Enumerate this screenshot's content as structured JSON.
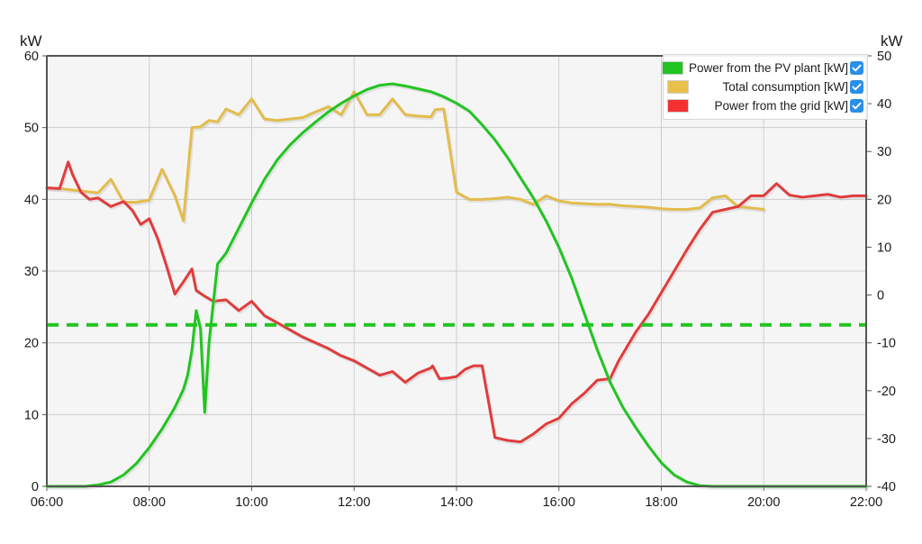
{
  "axes": {
    "left_unit": "kW",
    "right_unit": "kW",
    "left_ticks": [
      "60",
      "50",
      "40",
      "30",
      "20",
      "10",
      "0"
    ],
    "right_ticks": [
      "50",
      "40",
      "30",
      "20",
      "10",
      "0",
      "-10",
      "-20",
      "-30",
      "-40"
    ],
    "x_ticks": [
      "06:00",
      "08:00",
      "10:00",
      "12:00",
      "14:00",
      "16:00",
      "18:00",
      "20:00",
      "22:00"
    ]
  },
  "legend": {
    "items": [
      {
        "label": "Power from the PV plant [kW]",
        "color": "#22c422",
        "checked": true,
        "checkbox_color": "#2a8fe8"
      },
      {
        "label": "Total consumption [kW]",
        "color": "#e8c04a",
        "checked": true,
        "checkbox_color": "#2a8fe8"
      },
      {
        "label": "Power from the grid [kW]",
        "color": "#f43030",
        "checked": true,
        "checkbox_color": "#2a8fe8"
      }
    ]
  },
  "colors": {
    "pv": "#22c422",
    "consumption": "#e3bc4c",
    "grid": "#e03c3c",
    "plot_background": "#f2f2f2",
    "grid_line": "#c9c9c9",
    "axis_line": "#555555",
    "text": "#1a1a1a",
    "threshold": "#22c422"
  },
  "chart_data": {
    "type": "line",
    "title": "",
    "xlabel": "",
    "ylabel": "kW",
    "ylim": [
      0,
      60
    ],
    "y2lim": [
      -40,
      50
    ],
    "xlim": [
      "06:00",
      "22:00"
    ],
    "grid": true,
    "legend_position": "top-right",
    "x_tick_labels": [
      "06:00",
      "08:00",
      "10:00",
      "12:00",
      "14:00",
      "16:00",
      "18:00",
      "20:00",
      "22:00"
    ],
    "y_tick_labels": [
      "0",
      "10",
      "20",
      "30",
      "40",
      "50",
      "60"
    ],
    "y2_tick_labels": [
      "-40",
      "-30",
      "-20",
      "-10",
      "0",
      "10",
      "20",
      "30",
      "40",
      "50"
    ],
    "annotations": [
      {
        "name": "pv-threshold-dashed-line",
        "value": 22.5,
        "axis": "left",
        "style": "dashed",
        "color": "#22c422"
      }
    ],
    "x_minutes_start": 360,
    "x_minutes_end": 1320,
    "series": [
      {
        "name": "Power from the PV plant [kW]",
        "color": "#22c422",
        "axis": "left",
        "x": [
          360,
          375,
          390,
          405,
          420,
          435,
          450,
          465,
          480,
          495,
          510,
          520,
          525,
          530,
          535,
          540,
          545,
          550,
          560,
          570,
          585,
          600,
          615,
          630,
          645,
          660,
          675,
          690,
          705,
          720,
          735,
          750,
          765,
          780,
          795,
          810,
          825,
          840,
          855,
          870,
          885,
          900,
          915,
          930,
          945,
          960,
          975,
          990,
          1005,
          1020,
          1035,
          1050,
          1065,
          1080,
          1095,
          1110,
          1125,
          1140,
          1155,
          1170,
          1185,
          1200,
          1260,
          1320
        ],
        "values": [
          0,
          0,
          0,
          0,
          0.2,
          0.6,
          1.6,
          3.2,
          5.4,
          8.0,
          11.0,
          13.5,
          15.5,
          19.0,
          24.5,
          22.0,
          10.3,
          20.0,
          31.0,
          32.5,
          36.0,
          39.5,
          42.8,
          45.5,
          47.6,
          49.3,
          50.8,
          52.2,
          53.4,
          54.4,
          55.3,
          55.9,
          56.1,
          55.8,
          55.4,
          55.0,
          54.3,
          53.4,
          52.3,
          50.4,
          48.3,
          45.8,
          43.0,
          40.2,
          37.0,
          33.3,
          29.0,
          24.0,
          19.0,
          14.5,
          11.0,
          8.2,
          5.6,
          3.3,
          1.6,
          0.6,
          0.1,
          0,
          0,
          0,
          0,
          0,
          0,
          0
        ]
      },
      {
        "name": "Total consumption [kW]",
        "color": "#e3bc4c",
        "axis": "left",
        "x": [
          360,
          375,
          390,
          405,
          420,
          435,
          450,
          465,
          480,
          495,
          510,
          520,
          530,
          540,
          550,
          560,
          570,
          585,
          600,
          615,
          630,
          645,
          660,
          675,
          690,
          705,
          720,
          735,
          750,
          765,
          780,
          795,
          810,
          815,
          825,
          840,
          855,
          870,
          885,
          900,
          915,
          930,
          945,
          960,
          975,
          990,
          1005,
          1020,
          1035,
          1050,
          1065,
          1080,
          1095,
          1110,
          1125,
          1140,
          1155,
          1170,
          1185,
          1200
        ],
        "values": [
          41.6,
          41.5,
          41.3,
          41.1,
          40.9,
          42.8,
          39.6,
          39.6,
          39.9,
          44.2,
          40.5,
          37.0,
          50.0,
          50.1,
          51.0,
          50.8,
          52.6,
          51.8,
          54.0,
          51.2,
          51.0,
          51.2,
          51.4,
          52.2,
          52.9,
          51.8,
          55.0,
          51.8,
          51.8,
          54.0,
          51.8,
          51.6,
          51.5,
          52.5,
          52.6,
          41.0,
          40.0,
          40.0,
          40.1,
          40.3,
          40.0,
          39.3,
          40.5,
          39.8,
          39.5,
          39.4,
          39.3,
          39.3,
          39.1,
          39.0,
          38.9,
          38.7,
          38.6,
          38.6,
          38.8,
          40.2,
          40.5,
          39.0,
          38.8,
          38.6
        ]
      },
      {
        "name": "Power from the grid [kW]",
        "color": "#e03c3c",
        "axis": "left",
        "x": [
          360,
          375,
          385,
          390,
          400,
          410,
          420,
          435,
          450,
          460,
          470,
          480,
          490,
          500,
          510,
          520,
          530,
          535,
          545,
          555,
          570,
          585,
          600,
          615,
          630,
          645,
          660,
          675,
          690,
          705,
          720,
          735,
          750,
          765,
          780,
          795,
          810,
          812,
          820,
          830,
          840,
          850,
          860,
          870,
          885,
          900,
          915,
          930,
          945,
          960,
          975,
          990,
          1005,
          1020,
          1030,
          1040,
          1050,
          1065,
          1080,
          1095,
          1110,
          1125,
          1140,
          1155,
          1170,
          1185,
          1200,
          1215,
          1230,
          1245,
          1260,
          1275,
          1290,
          1305,
          1320
        ],
        "values": [
          41.6,
          41.5,
          45.2,
          43.5,
          41.0,
          40.0,
          40.2,
          39.0,
          39.7,
          38.5,
          36.5,
          37.3,
          34.5,
          30.8,
          26.8,
          28.5,
          30.3,
          27.3,
          26.5,
          25.8,
          26.0,
          24.5,
          25.8,
          23.8,
          22.8,
          21.8,
          20.8,
          20.0,
          19.2,
          18.2,
          17.5,
          16.5,
          15.5,
          16.0,
          14.5,
          15.8,
          16.5,
          16.8,
          15.0,
          15.1,
          15.3,
          16.3,
          16.8,
          16.8,
          6.8,
          6.4,
          6.2,
          7.3,
          8.7,
          9.5,
          11.5,
          13.0,
          14.8,
          15.0,
          17.5,
          19.5,
          21.5,
          24.0,
          27.0,
          30.0,
          33.0,
          35.8,
          38.2,
          38.6,
          39.0,
          40.5,
          40.5,
          42.2,
          40.6,
          40.3,
          40.5,
          40.7,
          40.3,
          40.5,
          40.5
        ]
      }
    ]
  }
}
